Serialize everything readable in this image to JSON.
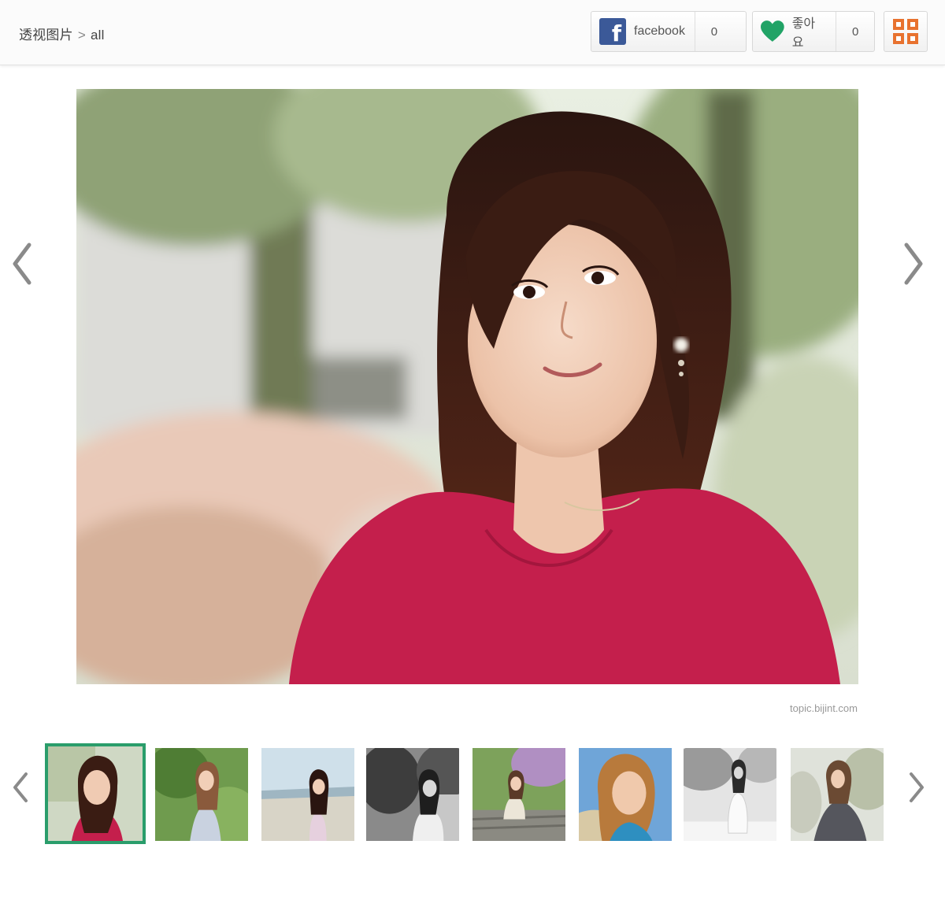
{
  "breadcrumb": {
    "section": "透视图片",
    "separator": ">",
    "current": "all"
  },
  "share": {
    "facebook_label": "facebook",
    "facebook_count": "0",
    "like_label": "좋아요",
    "like_count": "0"
  },
  "gallery": {
    "credit": "topic.bijint.com",
    "thumbnail_count": 8,
    "active_thumbnail": 1
  },
  "icons": {
    "facebook": "facebook-icon",
    "like": "heart-icon",
    "grid": "grid-icon",
    "prev": "chevron-left-icon",
    "next": "chevron-right-icon"
  },
  "colors": {
    "facebook_blue": "#3b5998",
    "like_green": "#21a366",
    "grid_orange": "#e8722f",
    "active_border": "#2a9d6b"
  }
}
